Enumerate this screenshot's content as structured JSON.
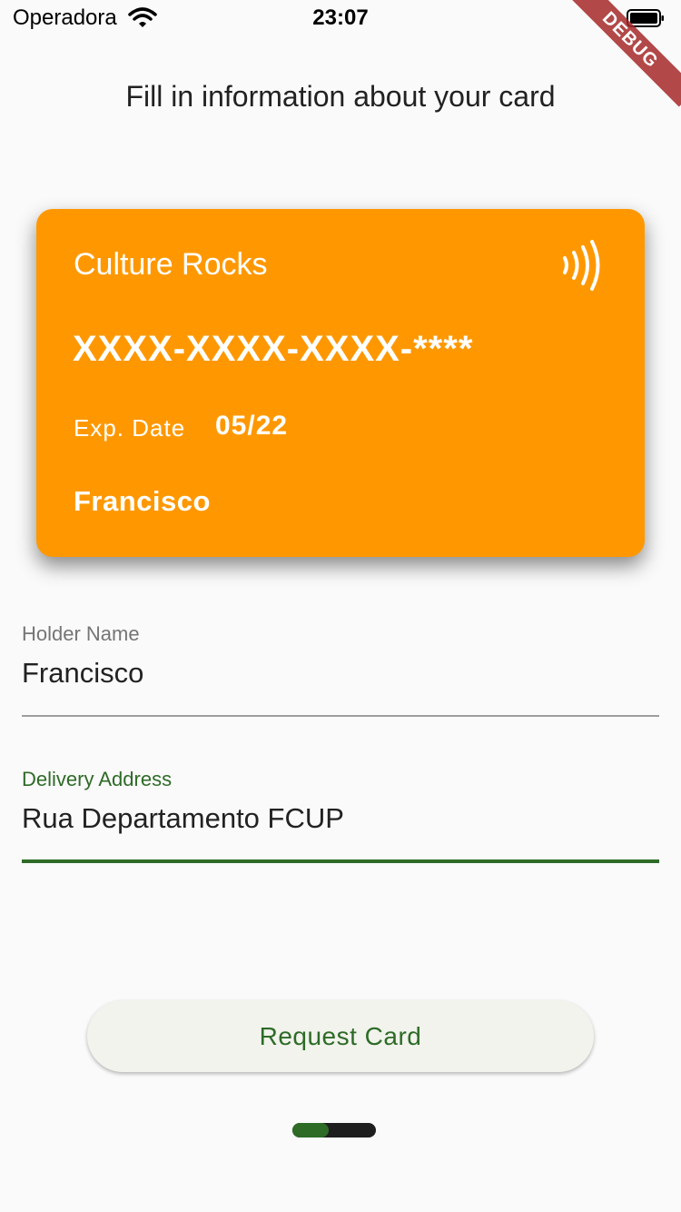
{
  "status_bar": {
    "carrier": "Operadora",
    "time": "23:07",
    "icons": [
      "wifi-icon",
      "battery-icon"
    ]
  },
  "debug_banner": "DEBUG",
  "page": {
    "title": "Fill in information about your card"
  },
  "card": {
    "brand": "Culture Rocks",
    "number": "XXXX-XXXX-XXXX-****",
    "exp_label": "Exp. Date",
    "exp_value": "05/22",
    "holder": "Francisco",
    "color": "#ff9800",
    "icon": "contactless-icon"
  },
  "form": {
    "holder_name": {
      "label": "Holder Name",
      "value": "Francisco"
    },
    "delivery_address": {
      "label": "Delivery Address",
      "value": "Rua Departamento FCUP"
    }
  },
  "button": {
    "label": "Request Card"
  },
  "page_indicator": {
    "current_page": 1,
    "total_pages": 2,
    "progress": 0.43
  },
  "colors": {
    "accent": "#2e6b27",
    "card": "#ff9800",
    "background": "#fafafa"
  }
}
